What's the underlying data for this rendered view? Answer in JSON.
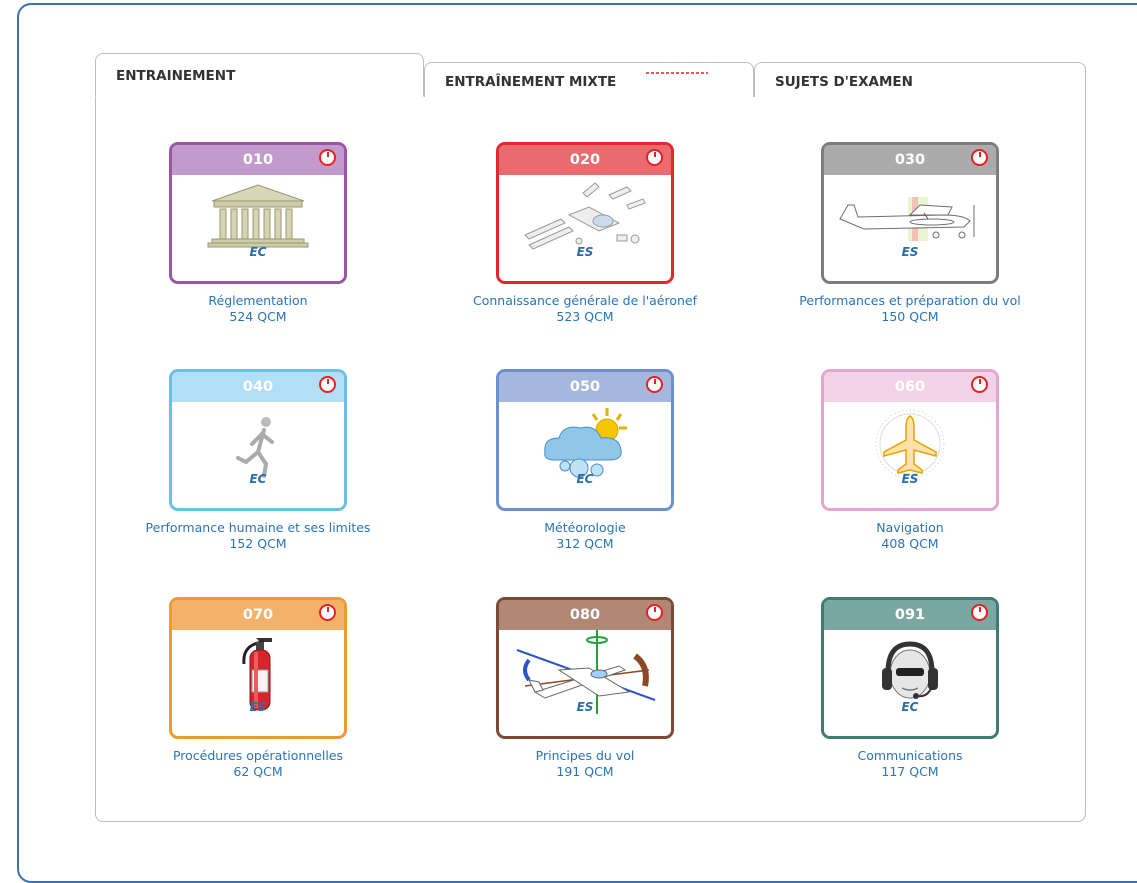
{
  "tabs": [
    {
      "label": "ENTRAINEMENT",
      "active": true
    },
    {
      "label": "ENTRAÎNEMENT MIXTE",
      "active": false
    },
    {
      "label": "SUJETS D'EXAMEN",
      "active": false
    }
  ],
  "modules": [
    {
      "code": "010",
      "badge": "EC",
      "title": "Réglementation",
      "count": "524 QCM",
      "color": "#9b55a8",
      "header_color": "#c29bcb",
      "icon": "courthouse-icon"
    },
    {
      "code": "020",
      "badge": "ES",
      "title": "Connaissance générale de l'aéronef",
      "count": "523 QCM",
      "color": "#e0282f",
      "header_color": "#e96b6f",
      "icon": "aircraft-parts-icon"
    },
    {
      "code": "030",
      "badge": "ES",
      "title": "Performances et préparation du vol",
      "count": "150 QCM",
      "color": "#7d7d7d",
      "header_color": "#ababab",
      "icon": "airplane-balance-icon"
    },
    {
      "code": "040",
      "badge": "EC",
      "title": "Performance humaine et ses limites",
      "count": "152 QCM",
      "color": "#6cc0e8",
      "header_color": "#b2dff5",
      "icon": "runner-icon"
    },
    {
      "code": "050",
      "badge": "EC",
      "title": "Météorologie",
      "count": "312 QCM",
      "color": "#6d8fcf",
      "header_color": "#a3b7df",
      "icon": "weather-icon"
    },
    {
      "code": "060",
      "badge": "ES",
      "title": "Navigation",
      "count": "408 QCM",
      "color": "#e3a6cf",
      "header_color": "#f2d2e6",
      "icon": "compass-plane-icon"
    },
    {
      "code": "070",
      "badge": "ES",
      "title": "Procédures opérationnelles",
      "count": "62 QCM",
      "color": "#ee9a34",
      "header_color": "#f3b26a",
      "icon": "fire-extinguisher-icon"
    },
    {
      "code": "080",
      "badge": "ES",
      "title": "Principes du vol",
      "count": "191 QCM",
      "color": "#7a4a36",
      "header_color": "#b08875",
      "icon": "flight-axes-icon"
    },
    {
      "code": "091",
      "badge": "EC",
      "title": "Communications",
      "count": "117 QCM",
      "color": "#3e7c74",
      "header_color": "#7aa7a1",
      "icon": "headset-pilot-icon"
    }
  ]
}
